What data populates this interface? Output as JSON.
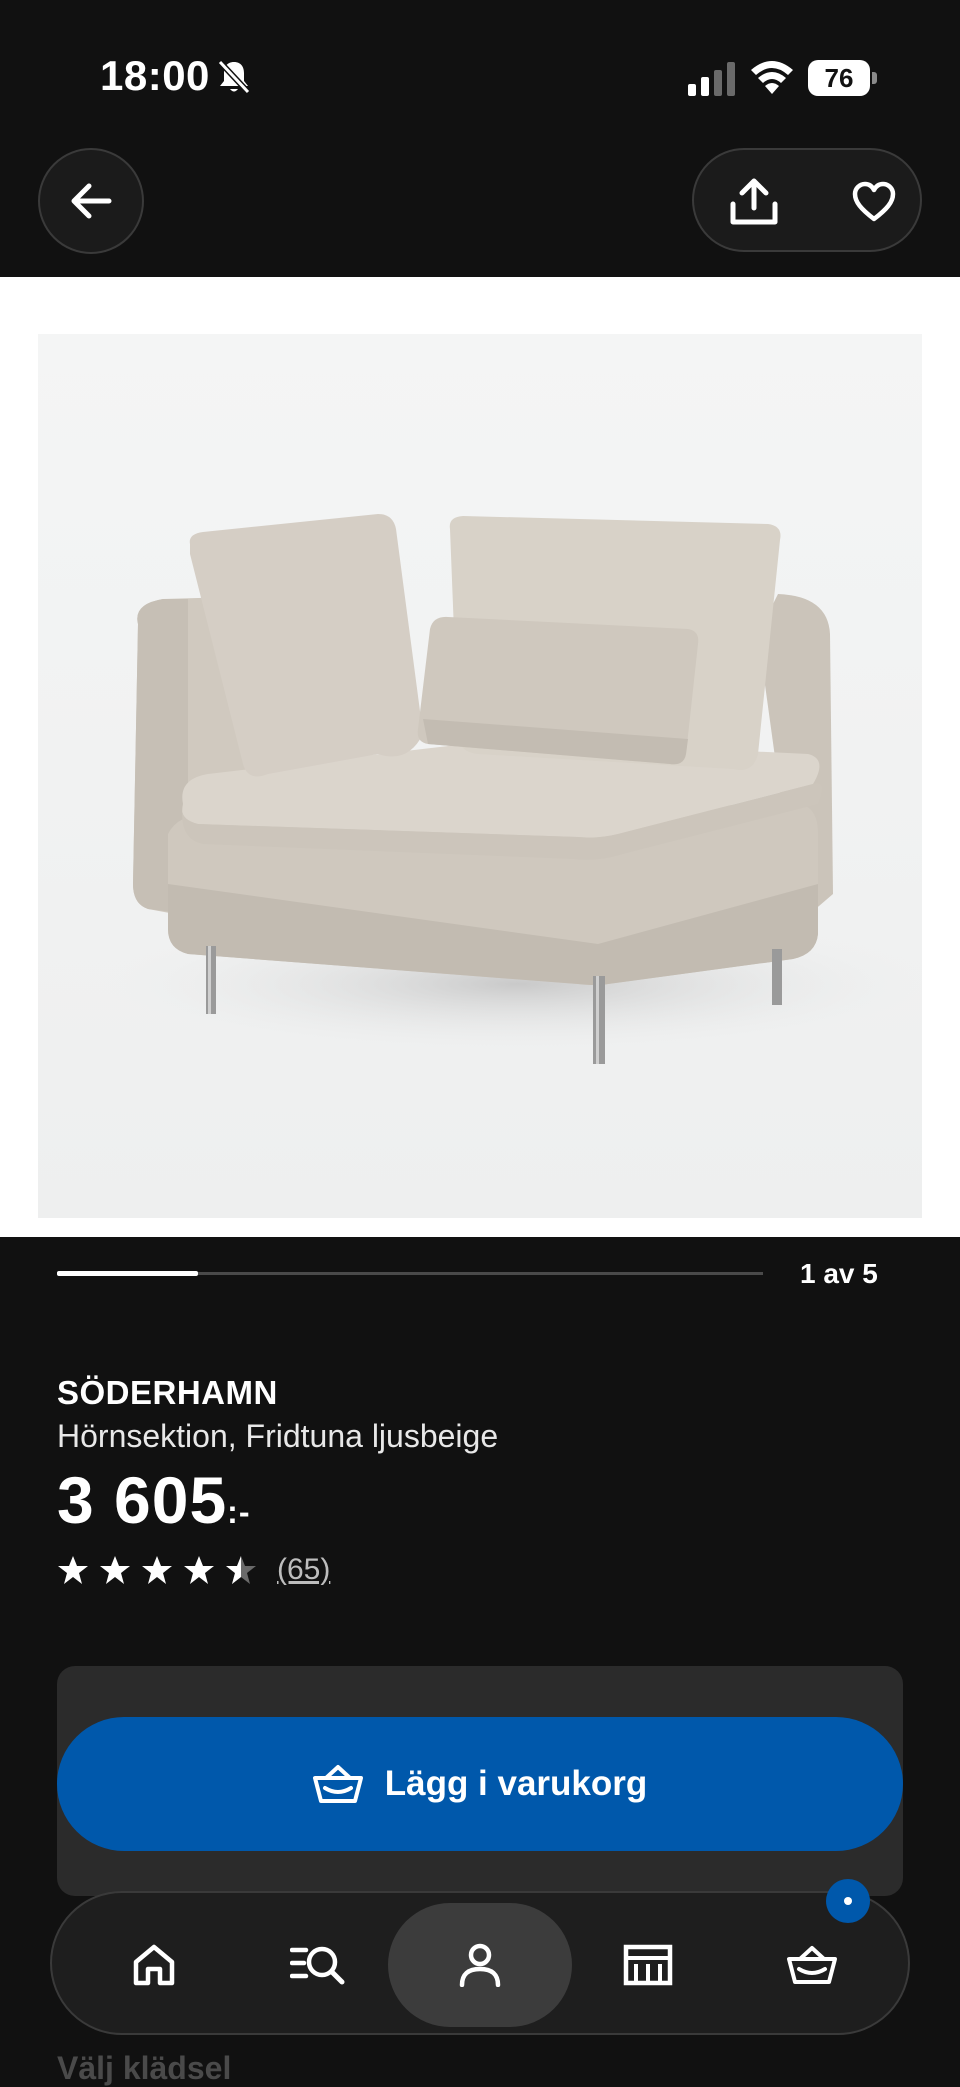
{
  "status_bar": {
    "time": "18:00",
    "battery": "76",
    "icons": [
      "bell-slash-icon",
      "signal-icon",
      "wifi-icon",
      "battery-icon"
    ]
  },
  "header": {
    "icons": [
      "arrow-left-icon",
      "share-icon",
      "heart-icon"
    ]
  },
  "gallery": {
    "counter": "1 av 5",
    "progress": 0.2
  },
  "product": {
    "name": "SÖDERHAMN",
    "description": "Hörnsektion, Fridtuna ljusbeige",
    "price": "3 605",
    "price_suffix": ":-",
    "rating": 4.5,
    "review_count": "(65)"
  },
  "cart": {
    "button_label": "Lägg i varukorg"
  },
  "bottom_nav": {
    "items": [
      "home-icon",
      "search-list-icon",
      "profile-icon",
      "store-icon",
      "cart-icon"
    ],
    "active": "profile-icon"
  },
  "next_section": {
    "title": "Välj klädsel"
  },
  "colors": {
    "background": "#111111",
    "accent": "#0058ab",
    "image_bg": "#f1f2f2"
  }
}
